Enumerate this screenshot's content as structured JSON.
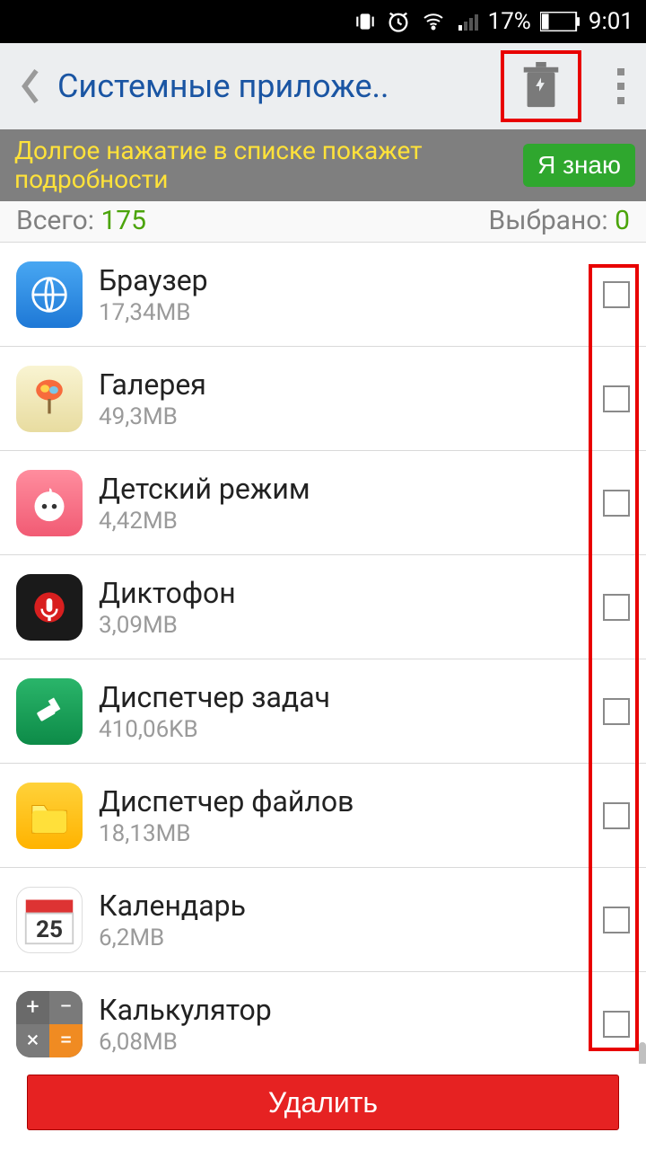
{
  "status": {
    "battery_pct": "17%",
    "time": "9:01"
  },
  "header": {
    "title": "Системные приложе.."
  },
  "hint": {
    "text": "Долгое нажатие в списке покажет подробности",
    "button": "Я знаю"
  },
  "totals": {
    "total_label": "Всего:",
    "total_value": "175",
    "selected_label": "Выбрано:",
    "selected_value": "0"
  },
  "apps": [
    {
      "name": "Браузер",
      "size": "17,34MB"
    },
    {
      "name": "Галерея",
      "size": "49,3MB"
    },
    {
      "name": "Детский режим",
      "size": "4,42MB"
    },
    {
      "name": "Диктофон",
      "size": "3,09MB"
    },
    {
      "name": "Диспетчер задач",
      "size": "410,06KB"
    },
    {
      "name": "Диспетчер файлов",
      "size": "18,13MB"
    },
    {
      "name": "Календарь",
      "size": "6,2MB"
    },
    {
      "name": "Калькулятор",
      "size": "6,08MB"
    }
  ],
  "footer": {
    "delete": "Удалить"
  }
}
